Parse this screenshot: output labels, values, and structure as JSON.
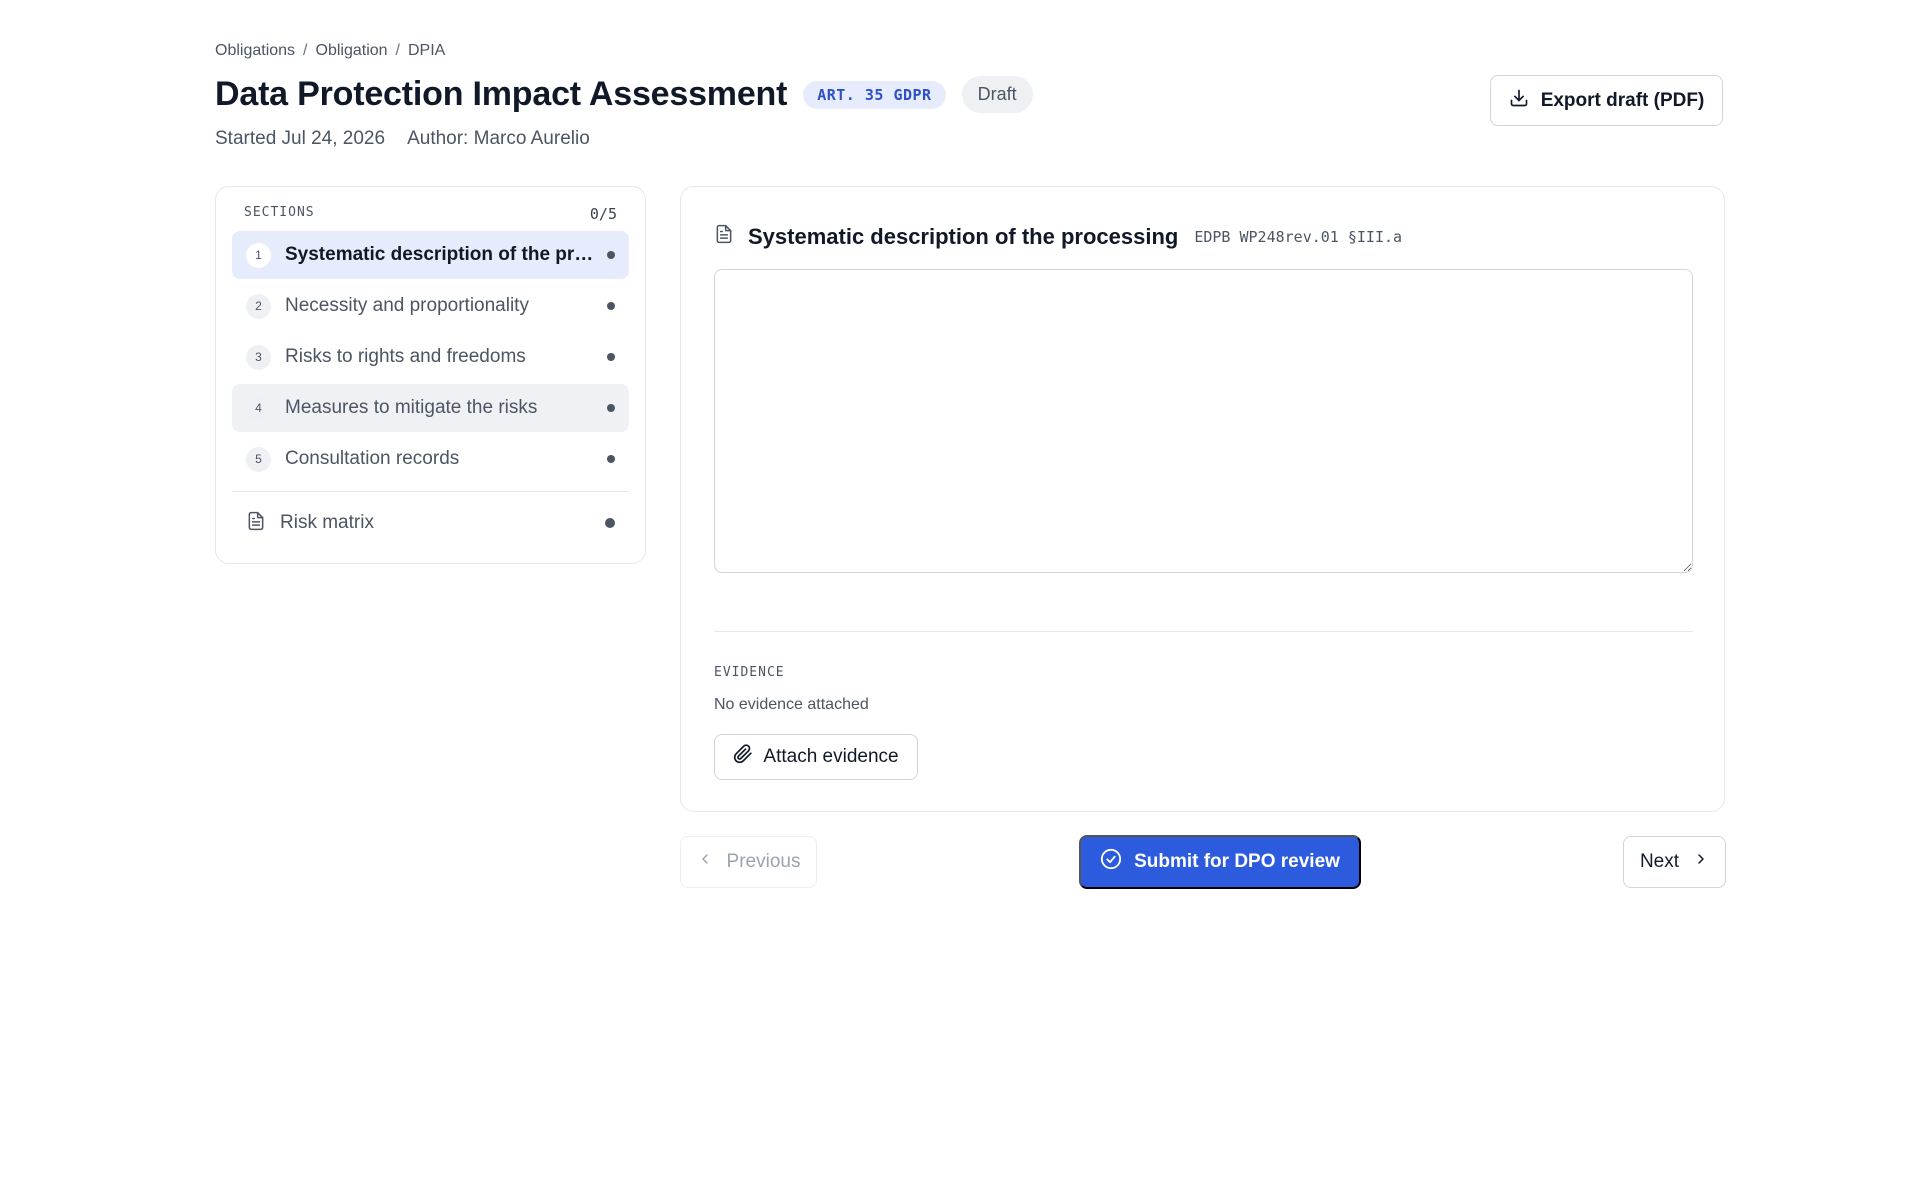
{
  "breadcrumb": {
    "items": [
      "Obligations",
      "Obligation",
      "DPIA"
    ],
    "separator": "/"
  },
  "header": {
    "title": "Data Protection Impact Assessment",
    "article_badge": "ART. 35 GDPR",
    "status": "Draft",
    "started": "Started Jul 24, 2026",
    "author": "Author: Marco Aurelio",
    "export_label": "Export draft (PDF)"
  },
  "sidebar": {
    "heading": "SECTIONS",
    "progress": "0/5",
    "items": [
      {
        "number": "1",
        "label": "Systematic description of the processing",
        "state": "active"
      },
      {
        "number": "2",
        "label": "Necessity and proportionality",
        "state": "default"
      },
      {
        "number": "3",
        "label": "Risks to rights and freedoms",
        "state": "default"
      },
      {
        "number": "4",
        "label": "Measures to mitigate the risks",
        "state": "hover"
      },
      {
        "number": "5",
        "label": "Consultation records",
        "state": "default"
      }
    ],
    "extra": {
      "label": "Risk matrix",
      "icon": "document-icon"
    }
  },
  "section": {
    "title": "Systematic description of the processing",
    "reference": "EDPB WP248rev.01 §III.a",
    "content": "",
    "icon": "document-icon"
  },
  "evidence": {
    "heading": "EVIDENCE",
    "empty_text": "No evidence attached",
    "attach_label": "Attach evidence"
  },
  "footer": {
    "previous_label": "Previous",
    "submit_label": "Submit for DPO review",
    "next_label": "Next"
  },
  "colors": {
    "accent": "#2d5bde",
    "active_bg": "#e6ecfb",
    "badge_text": "#2f4fc4"
  }
}
